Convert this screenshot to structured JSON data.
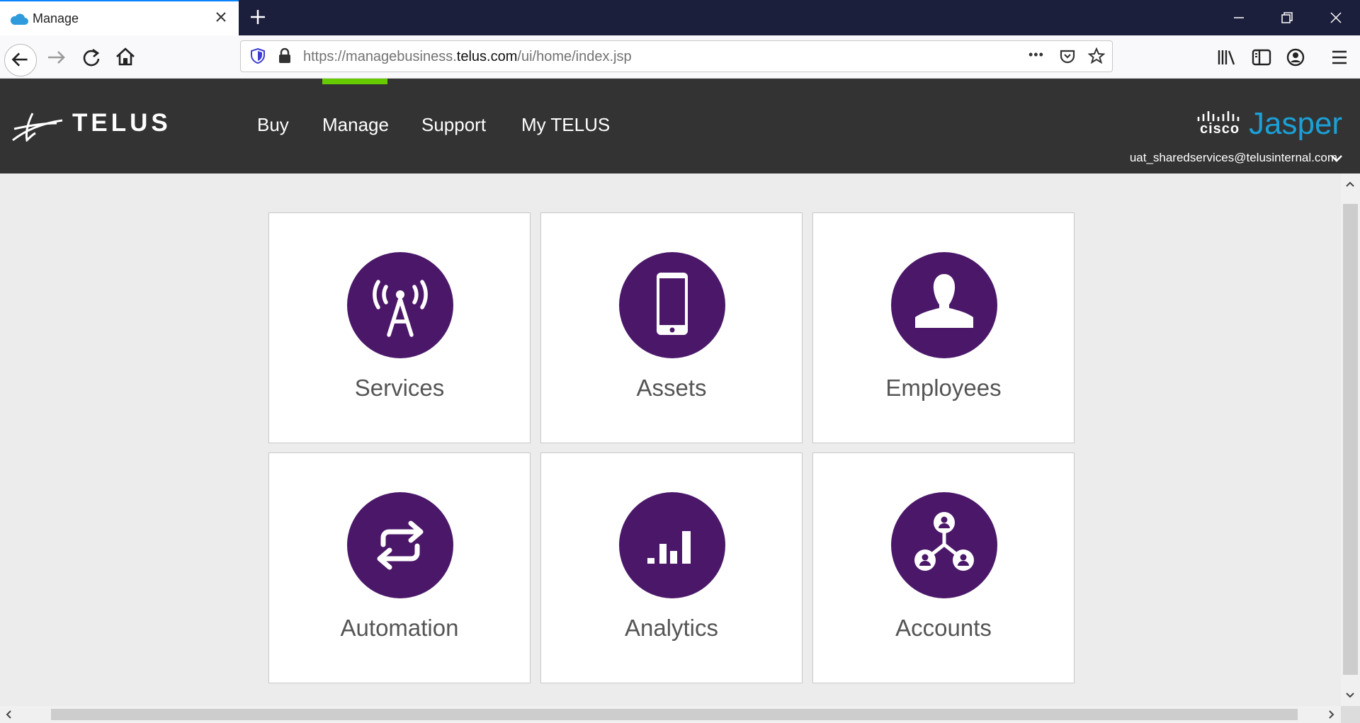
{
  "browser": {
    "tab_title": "Manage",
    "url_prefix": "https://managebusiness.",
    "url_host": "telus.com",
    "url_path": "/ui/home/index.jsp",
    "more_glyph": "•••"
  },
  "header": {
    "logo_text": "TELUS",
    "nav": [
      "Buy",
      "Manage",
      "Support",
      "My TELUS"
    ],
    "active_nav": "Manage",
    "cisco_text": "cisco",
    "jasper_text": "Jasper",
    "user_email": "uat_sharedservices@telusinternal.com"
  },
  "tiles": [
    {
      "label": "Services",
      "icon": "antenna-icon"
    },
    {
      "label": "Assets",
      "icon": "smartphone-icon"
    },
    {
      "label": "Employees",
      "icon": "person-icon"
    },
    {
      "label": "Automation",
      "icon": "exchange-arrows-icon"
    },
    {
      "label": "Analytics",
      "icon": "bar-chart-icon"
    },
    {
      "label": "Accounts",
      "icon": "account-network-icon"
    }
  ],
  "colors": {
    "tile_circle": "#4b1869",
    "header_bg": "#333333",
    "nav_accent": "#66cc00",
    "jasper_blue": "#1ba0d7",
    "tab_strip": "#1c1f3c"
  }
}
